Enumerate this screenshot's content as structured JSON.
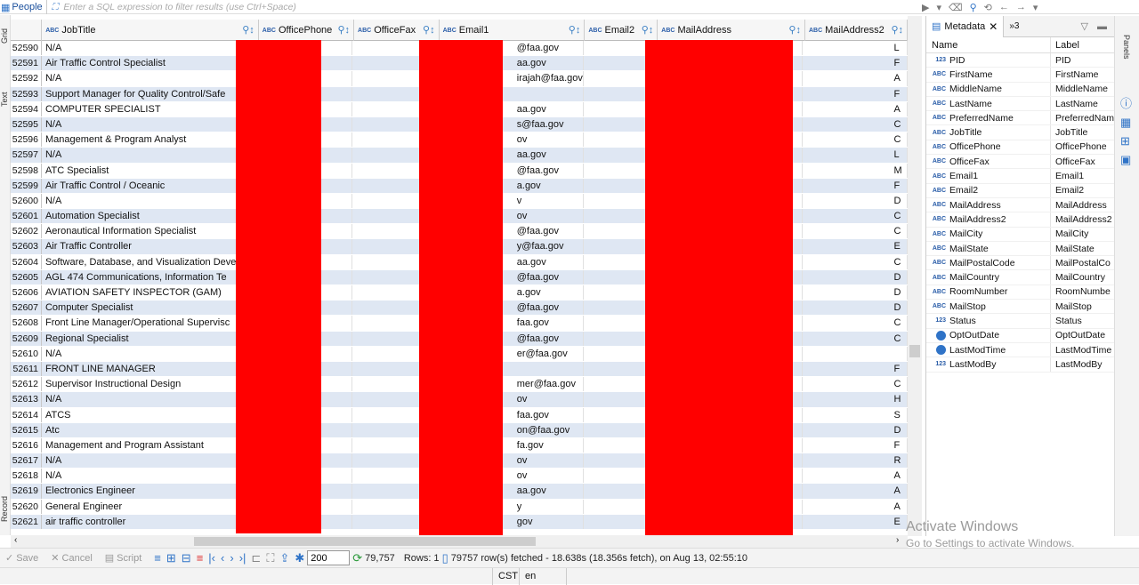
{
  "topbar": {
    "table_label": "People",
    "filter_placeholder": "Enter a SQL expression to filter results (use Ctrl+Space)"
  },
  "left_tabs": [
    "Grid",
    "Text",
    "Record"
  ],
  "columns": [
    {
      "name": "JobTitle",
      "type": "ABC"
    },
    {
      "name": "OfficePhone",
      "type": "ABC"
    },
    {
      "name": "OfficeFax",
      "type": "ABC"
    },
    {
      "name": "Email1",
      "type": "ABC"
    },
    {
      "name": "Email2",
      "type": "ABC"
    },
    {
      "name": "MailAddress",
      "type": "ABC"
    },
    {
      "name": "MailAddress2",
      "type": "ABC"
    }
  ],
  "rows": [
    {
      "n": "52590",
      "job": "N/A",
      "email": "@faa.gov",
      "addr2": "L"
    },
    {
      "n": "52591",
      "job": "Air Traffic Control Specialist",
      "email": "aa.gov",
      "addr2": "F"
    },
    {
      "n": "52592",
      "job": "N/A",
      "email": "irajah@faa.gov",
      "addr2": "A"
    },
    {
      "n": "52593",
      "job": "Support Manager for Quality Control/Safe",
      "email": "",
      "addr2": "F"
    },
    {
      "n": "52594",
      "job": "COMPUTER SPECIALIST",
      "email": "aa.gov",
      "addr2": "A"
    },
    {
      "n": "52595",
      "job": "N/A",
      "email": "s@faa.gov",
      "addr2": "C"
    },
    {
      "n": "52596",
      "job": "Management & Program Analyst",
      "email": "ov",
      "addr2": "C"
    },
    {
      "n": "52597",
      "job": "N/A",
      "email": "aa.gov",
      "addr2": "L"
    },
    {
      "n": "52598",
      "job": "ATC Specialist",
      "email": "@faa.gov",
      "addr2": "M"
    },
    {
      "n": "52599",
      "job": "Air Traffic Control / Oceanic",
      "email": "a.gov",
      "addr2": "F"
    },
    {
      "n": "52600",
      "job": "N/A",
      "email": "v",
      "addr2": "D"
    },
    {
      "n": "52601",
      "job": "Automation Specialist",
      "email": "ov",
      "addr2": "C"
    },
    {
      "n": "52602",
      "job": "Aeronautical Information Specialist",
      "email": "@faa.gov",
      "addr2": "C"
    },
    {
      "n": "52603",
      "job": "Air Traffic Controller",
      "email": "y@faa.gov",
      "addr2": "E"
    },
    {
      "n": "52604",
      "job": "Software, Database, and Visualization Deve",
      "email": "aa.gov",
      "addr2": "C"
    },
    {
      "n": "52605",
      "job": "AGL 474 Communications, Information Te",
      "email": "@faa.gov",
      "addr2": "D"
    },
    {
      "n": "52606",
      "job": "AVIATION SAFETY INSPECTOR (GAM)",
      "email": "a.gov",
      "addr2": "D"
    },
    {
      "n": "52607",
      "job": "Computer Specialist",
      "email": "@faa.gov",
      "addr2": "D"
    },
    {
      "n": "52608",
      "job": "Front Line Manager/Operational Supervisc",
      "email": "faa.gov",
      "addr2": "C"
    },
    {
      "n": "52609",
      "job": "Regional Specialist",
      "email": "@faa.gov",
      "addr2": "C"
    },
    {
      "n": "52610",
      "job": "N/A",
      "email": "er@faa.gov",
      "addr2": ""
    },
    {
      "n": "52611",
      "job": "FRONT LINE MANAGER",
      "email": "",
      "addr2": "F"
    },
    {
      "n": "52612",
      "job": "Supervisor Instructional Design",
      "email": "mer@faa.gov",
      "addr2": "C"
    },
    {
      "n": "52613",
      "job": "N/A",
      "email": "ov",
      "addr2": "H"
    },
    {
      "n": "52614",
      "job": "ATCS",
      "email": "faa.gov",
      "addr2": "S"
    },
    {
      "n": "52615",
      "job": "Atc",
      "email": "on@faa.gov",
      "addr2": "D"
    },
    {
      "n": "52616",
      "job": "Management and Program Assistant",
      "email": "fa.gov",
      "addr2": "F"
    },
    {
      "n": "52617",
      "job": "N/A",
      "email": "ov",
      "addr2": "R"
    },
    {
      "n": "52618",
      "job": "N/A",
      "email": "ov",
      "addr2": "A"
    },
    {
      "n": "52619",
      "job": "Electronics Engineer",
      "email": "aa.gov",
      "addr2": "A"
    },
    {
      "n": "52620",
      "job": "General Engineer",
      "email": "y",
      "addr2": "A"
    },
    {
      "n": "52621",
      "job": "air traffic controller",
      "email": "gov",
      "addr2": "E"
    }
  ],
  "panel": {
    "tab_label": "Metadata",
    "overflow_label": "»3",
    "col_name": "Name",
    "col_label": "Label",
    "items": [
      {
        "type": "123",
        "name": "PID",
        "label": "PID"
      },
      {
        "type": "ABC",
        "name": "FirstName",
        "label": "FirstName"
      },
      {
        "type": "ABC",
        "name": "MiddleName",
        "label": "MiddleName"
      },
      {
        "type": "ABC",
        "name": "LastName",
        "label": "LastName"
      },
      {
        "type": "ABC",
        "name": "PreferredName",
        "label": "PreferredNam"
      },
      {
        "type": "ABC",
        "name": "JobTitle",
        "label": "JobTitle"
      },
      {
        "type": "ABC",
        "name": "OfficePhone",
        "label": "OfficePhone"
      },
      {
        "type": "ABC",
        "name": "OfficeFax",
        "label": "OfficeFax"
      },
      {
        "type": "ABC",
        "name": "Email1",
        "label": "Email1"
      },
      {
        "type": "ABC",
        "name": "Email2",
        "label": "Email2"
      },
      {
        "type": "ABC",
        "name": "MailAddress",
        "label": "MailAddress"
      },
      {
        "type": "ABC",
        "name": "MailAddress2",
        "label": "MailAddress2"
      },
      {
        "type": "ABC",
        "name": "MailCity",
        "label": "MailCity"
      },
      {
        "type": "ABC",
        "name": "MailState",
        "label": "MailState"
      },
      {
        "type": "ABC",
        "name": "MailPostalCode",
        "label": "MailPostalCo"
      },
      {
        "type": "ABC",
        "name": "MailCountry",
        "label": "MailCountry"
      },
      {
        "type": "ABC",
        "name": "RoomNumber",
        "label": "RoomNumbe"
      },
      {
        "type": "ABC",
        "name": "MailStop",
        "label": "MailStop"
      },
      {
        "type": "123",
        "name": "Status",
        "label": "Status"
      },
      {
        "type": "clock",
        "name": "OptOutDate",
        "label": "OptOutDate"
      },
      {
        "type": "clock",
        "name": "LastModTime",
        "label": "LastModTime"
      },
      {
        "type": "123",
        "name": "LastModBy",
        "label": "LastModBy"
      }
    ]
  },
  "right_tabs": [
    "Panels"
  ],
  "bottom": {
    "save": "Save",
    "cancel": "Cancel",
    "script": "Script",
    "fetch_size": "200",
    "total_count": "79,757",
    "rows_label": "Rows: 1",
    "fetch_status": "79757 row(s) fetched - 18.638s (18.356s fetch), on Aug 13, 02:55:10"
  },
  "statusbar": {
    "timezone": "CST",
    "locale": "en"
  },
  "watermark": {
    "line1": "Activate Windows",
    "line2": "Go to Settings to activate Windows."
  },
  "colors": {
    "row_alt": "#dfe7f3",
    "redaction": "#ff0000",
    "accent": "#2f73c7"
  }
}
